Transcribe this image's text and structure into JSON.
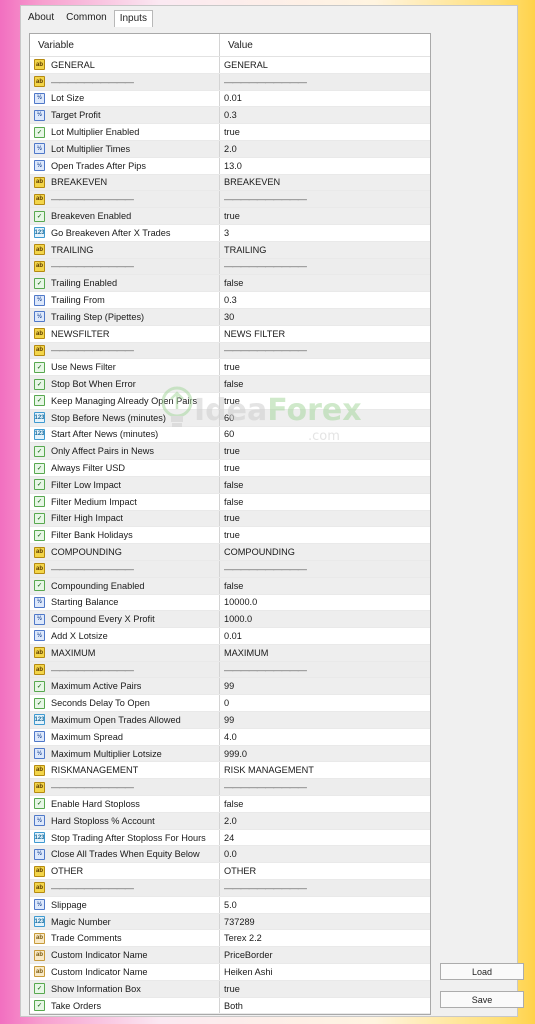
{
  "tabs": [
    {
      "label": "About",
      "active": false
    },
    {
      "label": "Common",
      "active": false
    },
    {
      "label": "Inputs",
      "active": true
    }
  ],
  "grid": {
    "header_variable": "Variable",
    "header_value": "Value",
    "rows": [
      {
        "type": "ab",
        "name": "GENERAL",
        "value": "GENERAL"
      },
      {
        "type": "ab",
        "sep": true,
        "name": "——————————",
        "value": "——————————"
      },
      {
        "type": "num",
        "name": "Lot Size",
        "value": "0.01"
      },
      {
        "type": "num",
        "name": "Target Profit",
        "value": "0.3"
      },
      {
        "type": "bool",
        "name": "Lot Multiplier Enabled",
        "value": "true"
      },
      {
        "type": "num",
        "name": "Lot Multiplier Times",
        "value": "2.0"
      },
      {
        "type": "num",
        "name": "Open Trades After Pips",
        "value": "13.0"
      },
      {
        "type": "ab",
        "name": "BREAKEVEN",
        "value": "BREAKEVEN"
      },
      {
        "type": "ab",
        "sep": true,
        "name": "——————————",
        "value": "——————————"
      },
      {
        "type": "bool",
        "name": "Breakeven Enabled",
        "value": "true"
      },
      {
        "type": "dbl",
        "name": "Go Breakeven After X Trades",
        "value": "3"
      },
      {
        "type": "ab",
        "name": "TRAILING",
        "value": "TRAILING"
      },
      {
        "type": "ab",
        "sep": true,
        "name": "——————————",
        "value": "——————————"
      },
      {
        "type": "bool",
        "name": "Trailing Enabled",
        "value": "false"
      },
      {
        "type": "num",
        "name": "Trailing From",
        "value": "0.3"
      },
      {
        "type": "num",
        "name": "Trailing Step (Pipettes)",
        "value": "30"
      },
      {
        "type": "ab",
        "name": "NEWSFILTER",
        "value": "NEWS FILTER"
      },
      {
        "type": "ab",
        "sep": true,
        "name": "——————————",
        "value": "——————————"
      },
      {
        "type": "bool",
        "name": "Use News Filter",
        "value": "true"
      },
      {
        "type": "bool",
        "name": "Stop Bot When Error",
        "value": "false"
      },
      {
        "type": "bool",
        "name": "Keep Managing Already Open Pairs",
        "value": "true"
      },
      {
        "type": "dbl",
        "name": "Stop Before News (minutes)",
        "value": "60"
      },
      {
        "type": "dbl",
        "name": "Start After News (minutes)",
        "value": "60"
      },
      {
        "type": "bool",
        "name": "Only Affect Pairs in News",
        "value": "true"
      },
      {
        "type": "bool",
        "name": "Always Filter USD",
        "value": "true"
      },
      {
        "type": "bool",
        "name": "Filter Low Impact",
        "value": "false"
      },
      {
        "type": "bool",
        "name": "Filter Medium Impact",
        "value": "false"
      },
      {
        "type": "bool",
        "name": "Filter High Impact",
        "value": "true"
      },
      {
        "type": "bool",
        "name": "Filter Bank Holidays",
        "value": "true"
      },
      {
        "type": "ab",
        "name": "COMPOUNDING",
        "value": "COMPOUNDING"
      },
      {
        "type": "ab",
        "sep": true,
        "name": "——————————",
        "value": "——————————"
      },
      {
        "type": "bool",
        "name": "Compounding Enabled",
        "value": "false"
      },
      {
        "type": "num",
        "name": "Starting Balance",
        "value": "10000.0"
      },
      {
        "type": "num",
        "name": "Compound Every X Profit",
        "value": "1000.0"
      },
      {
        "type": "num",
        "name": "Add X Lotsize",
        "value": "0.01"
      },
      {
        "type": "ab",
        "name": "MAXIMUM",
        "value": "MAXIMUM"
      },
      {
        "type": "ab",
        "sep": true,
        "name": "——————————",
        "value": "——————————"
      },
      {
        "type": "bool",
        "name": "Maximum Active Pairs",
        "value": "99"
      },
      {
        "type": "bool",
        "name": "Seconds Delay To Open",
        "value": "0"
      },
      {
        "type": "dbl",
        "name": "Maximum Open Trades Allowed",
        "value": "99"
      },
      {
        "type": "num",
        "name": "Maximum Spread",
        "value": "4.0"
      },
      {
        "type": "num",
        "name": "Maximum Multiplier Lotsize",
        "value": "999.0"
      },
      {
        "type": "ab",
        "name": "RISKMANAGEMENT",
        "value": "RISK MANAGEMENT"
      },
      {
        "type": "ab",
        "sep": true,
        "name": "——————————",
        "value": "——————————"
      },
      {
        "type": "bool",
        "name": "Enable Hard Stoploss",
        "value": "false"
      },
      {
        "type": "num",
        "name": "Hard Stoploss % Account",
        "value": "2.0"
      },
      {
        "type": "dbl",
        "name": "Stop Trading After Stoploss For Hours",
        "value": "24"
      },
      {
        "type": "num",
        "name": "Close All Trades When Equity Below",
        "value": "0.0"
      },
      {
        "type": "ab",
        "name": "OTHER",
        "value": "OTHER"
      },
      {
        "type": "ab",
        "sep": true,
        "name": "——————————",
        "value": "——————————"
      },
      {
        "type": "num",
        "name": "Slippage",
        "value": "5.0"
      },
      {
        "type": "dbl",
        "name": "Magic Number",
        "value": "737289"
      },
      {
        "type": "str",
        "name": "Trade Comments",
        "value": "Terex 2.2"
      },
      {
        "type": "str",
        "name": "Custom Indicator Name",
        "value": "PriceBorder"
      },
      {
        "type": "str",
        "name": "Custom Indicator Name",
        "value": "Heiken Ashi"
      },
      {
        "type": "bool",
        "name": "Show Information Box",
        "value": "true"
      },
      {
        "type": "bool",
        "name": "Take Orders",
        "value": "Both"
      }
    ]
  },
  "icon_glyphs": {
    "ab": "ab",
    "bool": "✓",
    "num": "½",
    "dbl": "123",
    "str": "ab"
  },
  "buttons": {
    "load": "Load",
    "save": "Save"
  },
  "watermark": {
    "brand_a": "Idea",
    "brand_b": "Forex",
    "domain": ".com"
  }
}
